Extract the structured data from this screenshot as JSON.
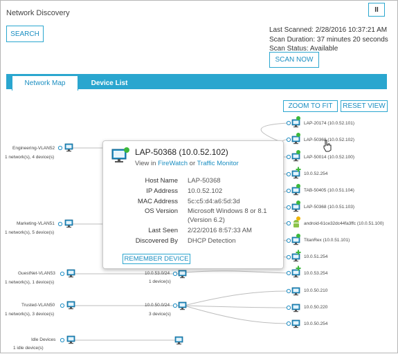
{
  "header": {
    "title": "Network Discovery",
    "pause_glyph": "II",
    "search_label": "SEARCH",
    "scan_now_label": "SCAN NOW",
    "last_scanned": "Last Scanned: 2/28/2016 10:37:21 AM",
    "scan_duration": "Scan Duration: 37 minutes 20 seconds",
    "scan_status": "Scan Status: Available"
  },
  "tabs": [
    {
      "label": "Network Map",
      "active": true
    },
    {
      "label": "Device List",
      "active": false
    }
  ],
  "toolbar": {
    "zoom_label": "ZOOM TO FIT",
    "reset_label": "RESET VIEW"
  },
  "left_groups": [
    {
      "name": "Engineering-VLAN52",
      "sub": "1 network(s), 4 device(s)"
    },
    {
      "name": "Marketing-VLAN51",
      "sub": "1 network(s), 5 device(s)"
    },
    {
      "name": "GuestNet-VLAN53",
      "sub": "1 network(s), 1 device(s)"
    },
    {
      "name": "Trusted-VLAN50",
      "sub": "1 network(s), 3 device(s)"
    },
    {
      "name": "Idle Devices",
      "sub": "1 idle device(s)"
    }
  ],
  "subnets": [
    {
      "name": "10.0.53.0/24",
      "sub": "1 device(s)"
    },
    {
      "name": "10.0.50.0/24",
      "sub": "3 device(s)"
    }
  ],
  "devices": [
    {
      "label": "LAP-20174 (10.0.52.101)",
      "status": "green"
    },
    {
      "label": "LAP-50368 (10.0.52.102)",
      "status": "green"
    },
    {
      "label": "LAP-50014 (10.0.52.100)",
      "status": "green"
    },
    {
      "label": "10.0.52.254",
      "status": "plus"
    },
    {
      "label": "TAB-50405 (10.0.51.104)",
      "status": "green"
    },
    {
      "label": "LAP-50368 (10.0.51.103)",
      "status": "green"
    },
    {
      "label": "android-61ce32dc44fa3ffc (10.0.51.100)",
      "status": "yellow"
    },
    {
      "label": "TitanRex (10.0.51.101)",
      "status": "green"
    },
    {
      "label": "10.0.51.254",
      "status": "plus"
    },
    {
      "label": "10.0.53.254",
      "status": "plus"
    },
    {
      "label": "10.0.50.210",
      "status": "none"
    },
    {
      "label": "10.0.50.220",
      "status": "none"
    },
    {
      "label": "10.0.50.254",
      "status": "none"
    }
  ],
  "popup": {
    "title": "LAP-50368 (10.0.52.102)",
    "view_prefix": "View in",
    "link1": "FireWatch",
    "view_or": "or",
    "link2": "Traffic Monitor",
    "rows": [
      {
        "k": "Host Name",
        "v": "LAP-50368"
      },
      {
        "k": "IP Address",
        "v": "10.0.52.102"
      },
      {
        "k": "MAC Address",
        "v": "5c:c5:d4:a6:5d:3d"
      },
      {
        "k": "OS Version",
        "v": "Microsoft Windows 8 or 8.1"
      },
      {
        "k": "",
        "v": "(Version 6.2)"
      },
      {
        "k": "Last Seen",
        "v": "2/22/2016 8:57:33 AM"
      },
      {
        "k": "Discovered By",
        "v": "DHCP Detection"
      }
    ],
    "remember_label": "REMEMBER DEVICE"
  },
  "colors": {
    "accent": "#2aa6cf",
    "monitor": "#1f8ec4",
    "green": "#3cb83c",
    "yellow": "#f0b400"
  }
}
